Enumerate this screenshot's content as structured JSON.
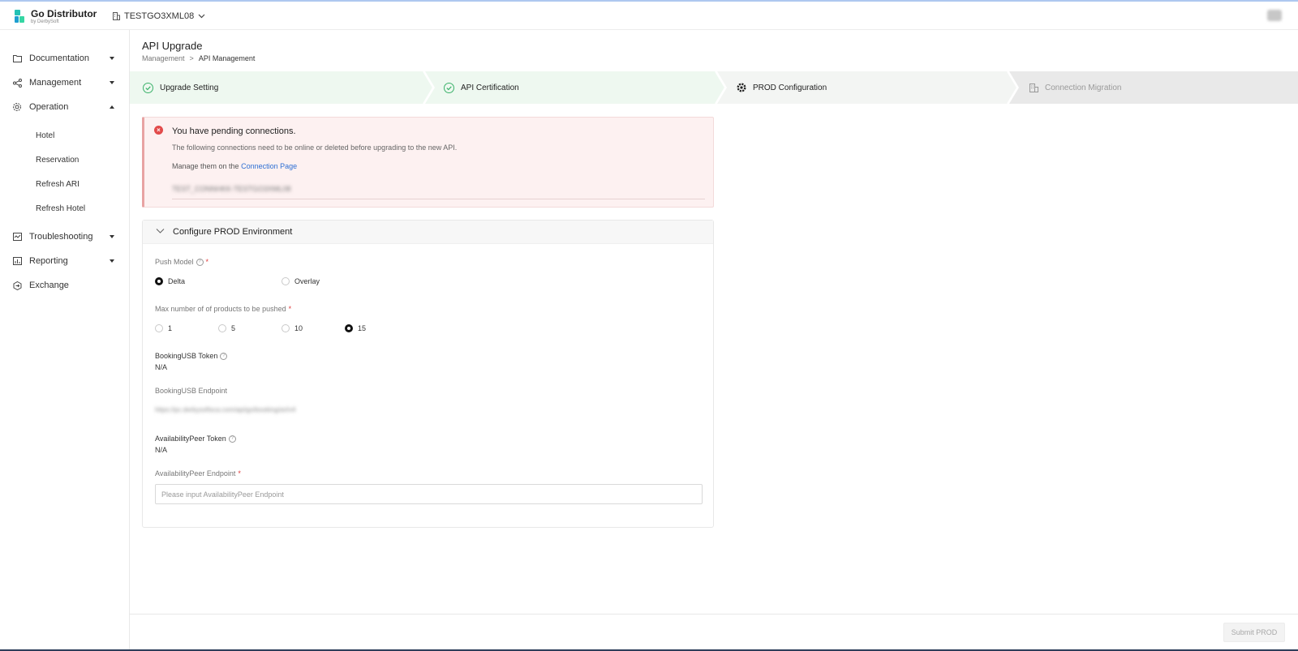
{
  "app": {
    "name": "Go Distributor",
    "sub": "by DerbySoft",
    "tenant": "TESTGO3XML08"
  },
  "sidebar": {
    "items": [
      {
        "label": "Documentation",
        "icon": "folder-icon"
      },
      {
        "label": "Management",
        "icon": "share-icon"
      },
      {
        "label": "Operation",
        "icon": "gear-icon"
      },
      {
        "label": "Troubleshooting",
        "icon": "monitor-icon"
      },
      {
        "label": "Reporting",
        "icon": "chart-icon"
      },
      {
        "label": "Exchange",
        "icon": "exchange-icon"
      }
    ],
    "operation_sub": [
      "Hotel",
      "Reservation",
      "Refresh ARI",
      "Refresh Hotel"
    ]
  },
  "page": {
    "title": "API Upgrade",
    "breadcrumb": [
      "Management",
      ">",
      "API Management"
    ]
  },
  "steps": [
    {
      "label": "Upgrade Setting",
      "status": "done"
    },
    {
      "label": "API Certification",
      "status": "done"
    },
    {
      "label": "PROD Configuration",
      "status": "active"
    },
    {
      "label": "Connection Migration",
      "status": "pending"
    }
  ],
  "alert": {
    "title": "You have pending connections.",
    "desc": "The following connections need to be online or deleted before upgrading to the new API.",
    "manage_prefix": "Manage them on the",
    "manage_link": "Connection Page",
    "blurred": "TEST_CONNHKK-TESTGO3XML08"
  },
  "config": {
    "title": "Configure PROD Environment",
    "push_model": {
      "label": "Push Model",
      "options": [
        "Delta",
        "Overlay"
      ],
      "selected": "Delta"
    },
    "max_products": {
      "label": "Max number of of products to be pushed",
      "options": [
        "1",
        "5",
        "10",
        "15"
      ],
      "selected": "15"
    },
    "booking_token": {
      "label": "BookingUSB Token",
      "value": "N/A"
    },
    "booking_endpoint": {
      "label": "BookingUSB Endpoint",
      "value": "https://pc.derbysoftsca.com/api/go/booking/ari/v4"
    },
    "avail_token": {
      "label": "AvailabilityPeer Token",
      "value": "N/A"
    },
    "avail_endpoint": {
      "label": "AvailabilityPeer Endpoint",
      "placeholder": "Please input AvailabilityPeer Endpoint",
      "value": ""
    }
  },
  "footer": {
    "submit": "Submit PROD"
  },
  "colors": {
    "accent": "#2d6fd4",
    "success": "#3bb26a",
    "error": "#e24b4b",
    "step_done_bg": "#eef8f0",
    "step_active_bg": "#f4f6f4",
    "step_pending_bg": "#e9e9e9"
  }
}
